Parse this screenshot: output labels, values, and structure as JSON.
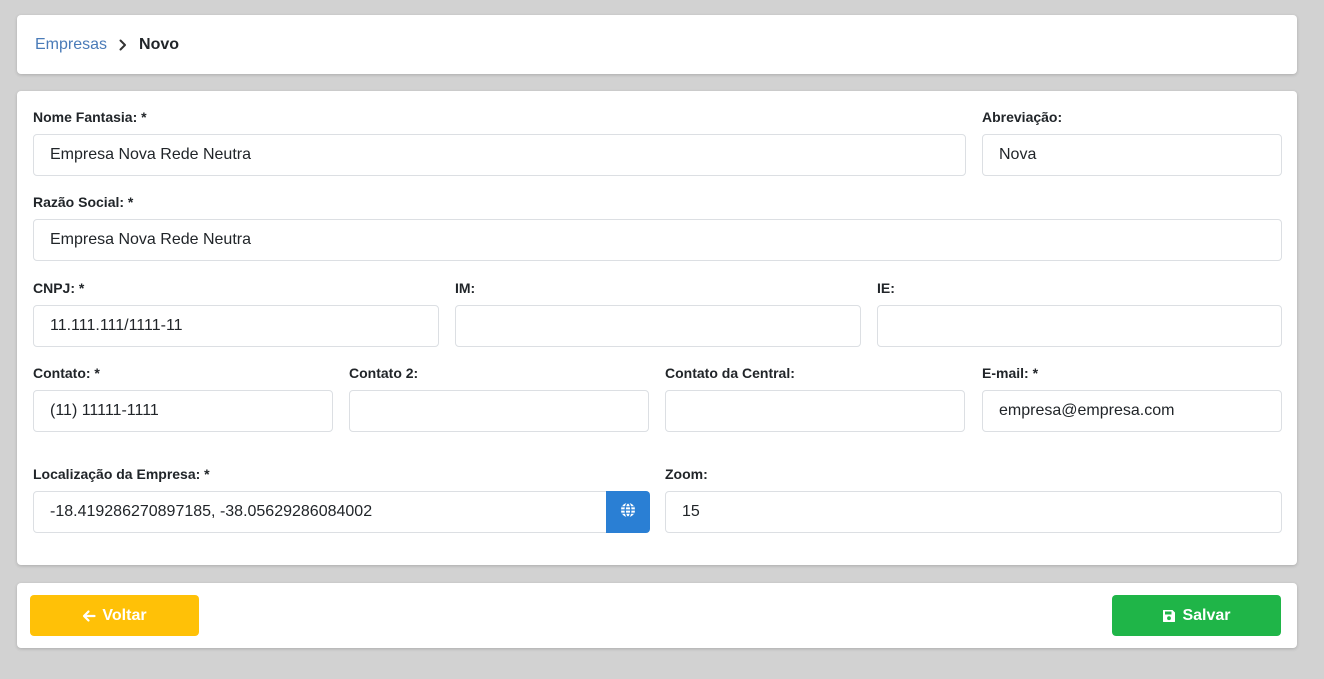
{
  "breadcrumb": {
    "parent": "Empresas",
    "current": "Novo"
  },
  "form": {
    "nome_fantasia": {
      "label": "Nome Fantasia: *",
      "value": "Empresa Nova Rede Neutra"
    },
    "abreviacao": {
      "label": "Abreviação:",
      "value": "Nova"
    },
    "razao_social": {
      "label": "Razão Social: *",
      "value": "Empresa Nova Rede Neutra"
    },
    "cnpj": {
      "label": "CNPJ: *",
      "value": "11.111.111/1111-11"
    },
    "im": {
      "label": "IM:",
      "value": ""
    },
    "ie": {
      "label": "IE:",
      "value": ""
    },
    "contato": {
      "label": "Contato: *",
      "value": "(11) 11111-1111"
    },
    "contato2": {
      "label": "Contato 2:",
      "value": ""
    },
    "contato_central": {
      "label": "Contato da Central:",
      "value": ""
    },
    "email": {
      "label": "E-mail: *",
      "value": "empresa@empresa.com"
    },
    "localizacao": {
      "label": "Localização da Empresa: *",
      "value": "-18.419286270897185, -38.05629286084002",
      "button_icon": "globe-icon"
    },
    "zoom": {
      "label": "Zoom:",
      "value": "15"
    }
  },
  "actions": {
    "back_label": "Voltar",
    "save_label": "Salvar"
  },
  "colors": {
    "back": "#ffc107",
    "save": "#1fb548",
    "globe_button": "#2a7fd4",
    "link": "#4a7bb8"
  }
}
